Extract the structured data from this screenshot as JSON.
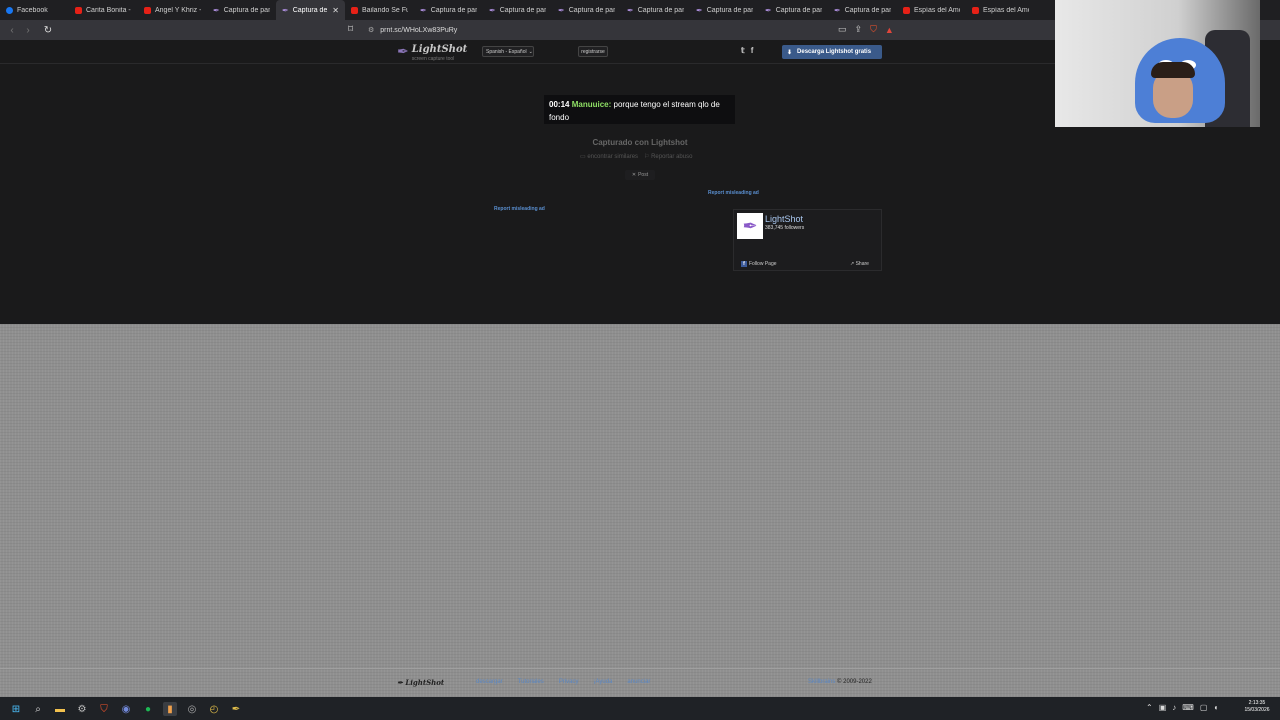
{
  "browser": {
    "tabs": [
      {
        "label": "Facebook",
        "icon": "facebook-icon"
      },
      {
        "label": "Carita Bonita - Y",
        "icon": "youtube-icon"
      },
      {
        "label": "Angel Y Khriz - Y",
        "icon": "youtube-icon"
      },
      {
        "label": "Captura de pant",
        "icon": "lightshot-icon"
      },
      {
        "label": "Captura de",
        "icon": "lightshot-icon",
        "active": true,
        "close": "✕"
      },
      {
        "label": "Bailando Se Fue",
        "icon": "youtube-icon"
      },
      {
        "label": "Captura de pant",
        "icon": "lightshot-icon"
      },
      {
        "label": "Captura de pant",
        "icon": "lightshot-icon"
      },
      {
        "label": "Captura de pant",
        "icon": "lightshot-icon"
      },
      {
        "label": "Captura de pant",
        "icon": "lightshot-icon"
      },
      {
        "label": "Captura de pant",
        "icon": "lightshot-icon"
      },
      {
        "label": "Captura de pant",
        "icon": "lightshot-icon"
      },
      {
        "label": "Captura de pant",
        "icon": "lightshot-icon"
      },
      {
        "label": "Espías del Amor",
        "icon": "youtube-icon"
      },
      {
        "label": "Espías del Amor",
        "icon": "youtube-icon"
      }
    ],
    "url": "prnt.sc/WHoLXw83PuRy"
  },
  "header": {
    "logo_name": "LightShot",
    "logo_sub": "screen capture tool",
    "language": "Spanish - Español",
    "register": "registrarse",
    "download_button": "Descarga Lightshot gratis"
  },
  "chat": {
    "time": "00:14",
    "user": "Manuuice:",
    "message": "porque tengo el stream qlo de fondo"
  },
  "screenshot": {
    "captured_with": "Capturado con Lightshot",
    "find_similar": "encontrar similares",
    "report_abuse": "Reportar abuso",
    "post": "Post",
    "report_ad_1": "Report misleading ad",
    "report_ad_2": "Report misleading ad"
  },
  "facebook_widget": {
    "page_name": "LightShot",
    "followers": "383,745 followers",
    "follow": "Follow Page",
    "share": "Share"
  },
  "footer": {
    "logo": "LightShot",
    "links": [
      "descargar",
      "Tutoriales",
      "Privacy",
      "¡Ayuda",
      "anunciar"
    ],
    "company": "Skillbrains",
    "copyright": "© 2009-2022"
  },
  "taskbar": {
    "clock_time": "2:13:35",
    "clock_date": "15/03/2026"
  }
}
